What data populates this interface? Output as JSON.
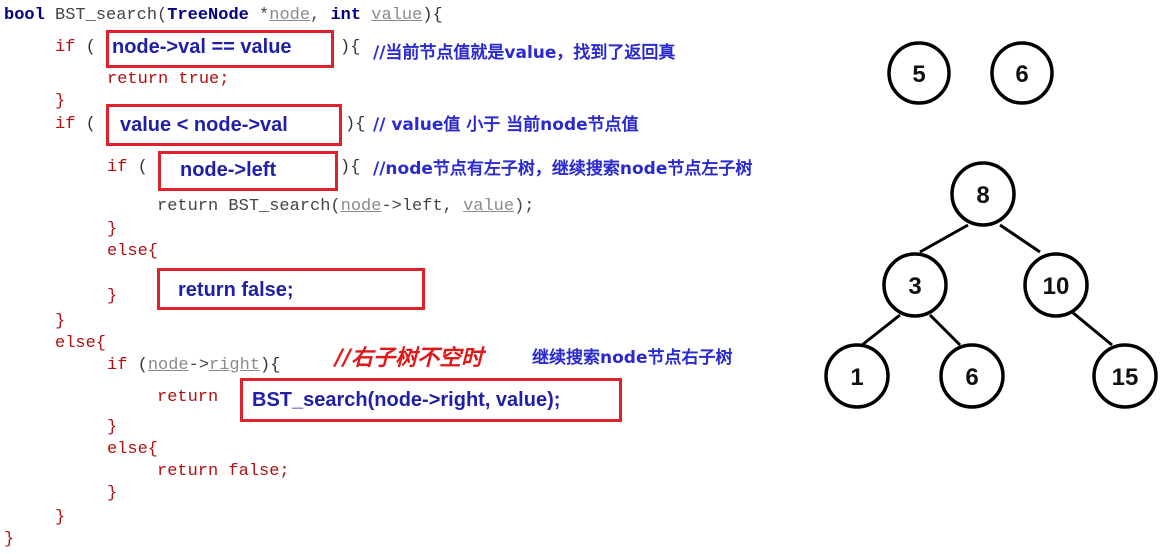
{
  "code": {
    "l1_kw": "bool",
    "l1_fn": " BST_search(",
    "l1_type": "TreeNode",
    "l1_mid": " *",
    "l1_node": "node",
    "l1_comma": ", ",
    "l1_int": "int",
    "l1_sp": " ",
    "l1_value": "value",
    "l1_end": "){",
    "l2_kw": "if",
    "l2_open": " (",
    "l2_close": "){",
    "l3_kw": "return",
    "l3_true": " true;",
    "l4": "}",
    "l5_kw": "if",
    "l5_open": " (",
    "l5_close": "){",
    "l6_kw": "if",
    "l6_open": " (",
    "l6_close": "){",
    "l7_ret": "return BST_search(",
    "l7_node": "node",
    "l7_mid": "->left, ",
    "l7_value": "value",
    "l7_end": ");",
    "l8": "}",
    "l9": "else{",
    "l10": "}",
    "l11": "}",
    "l12": "else{",
    "l13_kw": "if",
    "l13_open": " (",
    "l13_node": "node",
    "l13_mid": "->",
    "l13_right": "right",
    "l13_end": "){",
    "l14_ret": "return",
    "l15": "}",
    "l16": "else{",
    "l17_ret": "return false;",
    "l18": "}",
    "l19": "}",
    "l20": "}"
  },
  "boxes": {
    "b1": "node->val == value",
    "b2": "value < node->val",
    "b3": "node->left",
    "b4": "return false;",
    "b5": "BST_search(node->right, value);"
  },
  "notes": {
    "n1": "//当前节点值就是value，找到了返回真",
    "n2": "// value值 小于 当前node节点值",
    "n3": "//node节点有左子树，继续搜索node节点左子树",
    "n4": "//右子树不空时",
    "n5": "继续搜索node节点右子树"
  },
  "standalone_nodes": [
    "5",
    "6"
  ],
  "tree": {
    "root": "8",
    "left": "3",
    "right": "10",
    "left_left": "1",
    "left_right": "6",
    "right_right": "15"
  },
  "colors": {
    "box_border": "#e0202a",
    "box_text": "#1f1fa8",
    "note_blue": "#2a2ad0",
    "note_red": "#e01818",
    "keyword_red": "#b01010"
  }
}
